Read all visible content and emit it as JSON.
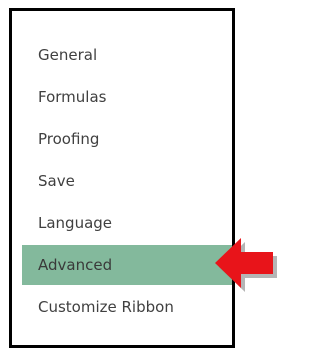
{
  "options_nav": {
    "items": [
      {
        "label": "General"
      },
      {
        "label": "Formulas"
      },
      {
        "label": "Proofing"
      },
      {
        "label": "Save"
      },
      {
        "label": "Language"
      },
      {
        "label": "Advanced",
        "selected": true
      },
      {
        "label": "Customize Ribbon"
      }
    ]
  },
  "colors": {
    "selected_bg": "#83b99c",
    "arrow": "#e8141a",
    "text": "#404040"
  },
  "callout": {
    "icon": "red-arrow-left-icon",
    "points_to": "Advanced"
  }
}
